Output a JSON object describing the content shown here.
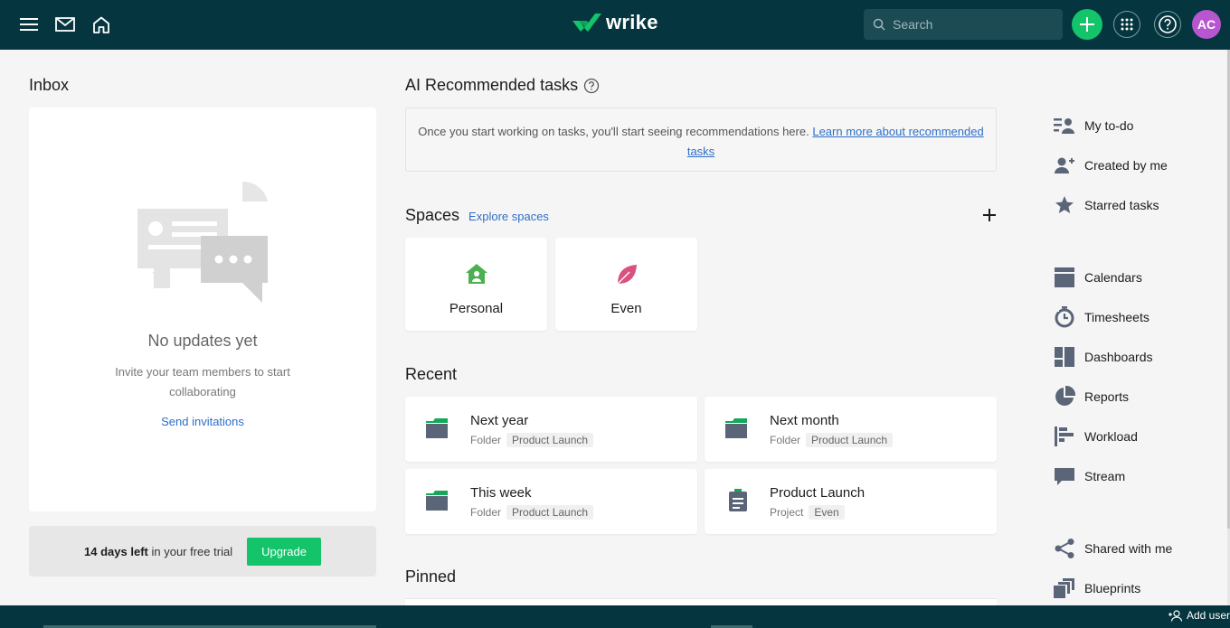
{
  "app": {
    "logo_text": "wrike"
  },
  "topbar": {
    "search_placeholder": "Search",
    "avatar_initials": "AC"
  },
  "inbox": {
    "title": "Inbox",
    "empty_title": "No updates yet",
    "empty_text": "Invite your team members to start collaborating",
    "send_invitations": "Send invitations"
  },
  "trial": {
    "days_left": "14 days left",
    "suffix": " in your free trial",
    "upgrade_label": "Upgrade"
  },
  "ai": {
    "title": "AI Recommended tasks",
    "message": "Once you start working on tasks, you'll start seeing recommendations here.",
    "link": "Learn more about recommended tasks"
  },
  "spaces": {
    "title": "Spaces",
    "explore": "Explore spaces",
    "items": [
      {
        "label": "Personal",
        "icon": "house-icon",
        "color": "#4caf50"
      },
      {
        "label": "Even",
        "icon": "leaf-icon",
        "color": "#d9517e"
      }
    ]
  },
  "recent": {
    "title": "Recent",
    "items": [
      {
        "name": "Next year",
        "type": "Folder",
        "tag": "Product Launch",
        "icon": "folder-icon"
      },
      {
        "name": "Next month",
        "type": "Folder",
        "tag": "Product Launch",
        "icon": "folder-icon"
      },
      {
        "name": "This week",
        "type": "Folder",
        "tag": "Product Launch",
        "icon": "folder-icon"
      },
      {
        "name": "Product Launch",
        "type": "Project",
        "tag": "Even",
        "icon": "project-icon"
      }
    ]
  },
  "pinned": {
    "title": "Pinned"
  },
  "right_nav": {
    "items": [
      {
        "label": "My to-do",
        "icon": "todo-icon"
      },
      {
        "label": "Created by me",
        "icon": "user-plus-icon"
      },
      {
        "label": "Starred tasks",
        "icon": "star-icon"
      },
      {
        "label": "Calendars",
        "icon": "calendar-icon"
      },
      {
        "label": "Timesheets",
        "icon": "timesheet-icon"
      },
      {
        "label": "Dashboards",
        "icon": "dashboard-icon"
      },
      {
        "label": "Reports",
        "icon": "pie-icon"
      },
      {
        "label": "Workload",
        "icon": "workload-icon"
      },
      {
        "label": "Stream",
        "icon": "stream-icon"
      },
      {
        "label": "Shared with me",
        "icon": "share-icon"
      },
      {
        "label": "Blueprints",
        "icon": "blueprint-icon"
      }
    ]
  },
  "footer": {
    "add_user": "Add user"
  },
  "colors": {
    "topbar": "#05353e",
    "accent_green": "#13c46a",
    "link": "#2f6ec7",
    "icon_slate": "#5a6578"
  }
}
